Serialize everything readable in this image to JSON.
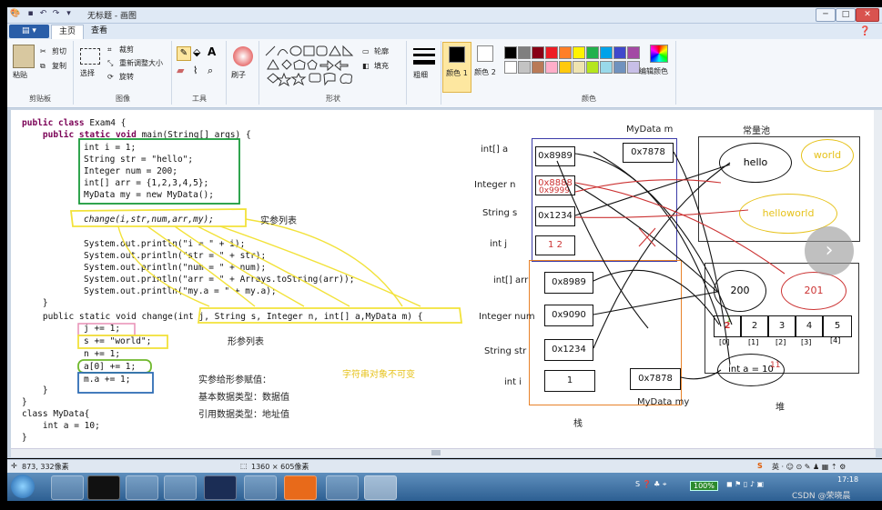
{
  "window": {
    "title": "无标题 - 画图"
  },
  "tabs": {
    "file": "▤ ▾",
    "home": "主页",
    "view": "查看"
  },
  "ribbon": {
    "clipboard": {
      "paste": "粘贴",
      "cut": "剪切",
      "copy": "复制",
      "label": "剪贴板"
    },
    "image": {
      "select": "选择",
      "crop": "裁剪",
      "resize": "重新调整大小",
      "rotate": "旋转",
      "label": "图像"
    },
    "tools": {
      "label": "工具"
    },
    "brushes": {
      "label": "刷子"
    },
    "shapes": {
      "outline": "轮廓",
      "fill": "填充",
      "label": "形状"
    },
    "size": {
      "label": "粗细"
    },
    "color1": {
      "label": "颜色 1"
    },
    "color2": {
      "label": "颜色 2"
    },
    "colors": {
      "label": "颜色",
      "edit": "编辑颜色",
      "palette": [
        "#000000",
        "#7f7f7f",
        "#880015",
        "#ed1c24",
        "#ff7f27",
        "#fff200",
        "#22b14c",
        "#00a2e8",
        "#3f48cc",
        "#a349a4",
        "#ffffff",
        "#c3c3c3",
        "#b97a57",
        "#ffaec9",
        "#ffc90e",
        "#efe4b0",
        "#b5e61d",
        "#99d9ea",
        "#7092be",
        "#c8bfe7"
      ]
    }
  },
  "code": {
    "l1": "public class Exam4 {",
    "l2": "    public static void main(String[] args) {",
    "l3": "int i = 1;",
    "l4": "String str = \"hello\";",
    "l5": "Integer num = 200;",
    "l6": "int[] arr = {1,2,3,4,5};",
    "l7": "MyData my = new MyData();",
    "l8": "change(i,str,num,arr,my);",
    "l9": "System.out.println(\"i = \" + i);",
    "l10": "System.out.println(\"str = \" + str);",
    "l11": "System.out.println(\"num = \" + num);",
    "l12": "System.out.println(\"arr = \" + Arrays.toString(arr));",
    "l13": "System.out.println(\"my.a = \" + my.a);",
    "l14": "    }",
    "l15": "    public static void change(",
    "l15b": "int j, String s, Integer n, int[] a,MyData m",
    "l15c": ") {",
    "l16": "j += 1;",
    "l17": "s += \"world\";",
    "l18": "n += 1;",
    "l19": "a[0] += 1;",
    "l20": "m.a += 1;",
    "l21": "    }",
    "l22": "}",
    "l23": "class MyData{",
    "l24": "    int a = 10;",
    "l25": "}"
  },
  "notes": {
    "actual_params": "实参列表",
    "formal_params": "形参列表",
    "assign_title": "实参给形参赋值：",
    "primitive": "基本数据类型：数据值",
    "reference": "引用数据类型：地址值",
    "immutable": "字符串对象不可变"
  },
  "diagram": {
    "mydata_m": "MyData m",
    "const_pool": "常量池",
    "labels_top": [
      "int[] a",
      "Integer n",
      "String s",
      "int j"
    ],
    "cells_top": [
      "0x8989",
      "0x8888",
      "0x1234",
      "1 2"
    ],
    "cell_m": "0x7878",
    "n_overwrite": "0x9999",
    "labels_bottom": [
      "int[] arr",
      "Integer num",
      "String str",
      "int i"
    ],
    "cells_bottom": [
      "0x8989",
      "0x9090",
      "0x1234",
      "1"
    ],
    "cell_my": "0x7878",
    "mydata_my": "MyData my",
    "stack": "栈",
    "heap": "堆",
    "pool_hello": "hello",
    "pool_world": "world",
    "pool_helloworld": "helloworld",
    "heap_200": "200",
    "heap_201": "201",
    "array_values": [
      "2",
      "2",
      "3",
      "4",
      "5"
    ],
    "array_overwrite": "1",
    "array_idx": [
      "[0]",
      "[1]",
      "[2]",
      "[3]",
      "[4]"
    ],
    "int_a": "int a = 10",
    "int_a_overwrite": "11"
  },
  "status": {
    "cursor": "873, 332像素",
    "size": "1360 × 605像素"
  },
  "taskbar": {
    "battery": "100%",
    "time": "17:18",
    "watermark": "CSDN @荣晓晨"
  }
}
